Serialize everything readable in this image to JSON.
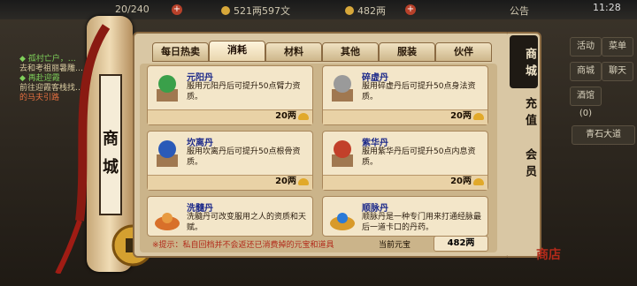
{
  "topbar": {
    "stamina": "20/240",
    "coins": "521两597文",
    "ingots": "482两",
    "notice": "公告",
    "time": "11:28"
  },
  "left_quest": {
    "line1": "◆ 孤村亡户，…",
    "line2": "去和考祖丽暑雕…",
    "line3": "◆ 再赴迎霞",
    "line4": "前往迎霞客栈找…",
    "line5": "的马夫引路"
  },
  "right_menu": {
    "b1": "活动",
    "b2": "菜单",
    "b3": "商城",
    "b4": "聊天",
    "b5": "酒馆(0)",
    "b6": "",
    "road": "青石大道"
  },
  "shop": {
    "title": "商城",
    "tabs": [
      "每日热卖",
      "消耗",
      "材料",
      "其他",
      "服装",
      "伙伴"
    ],
    "active_tab": "消耗",
    "right_tabs": [
      "商城",
      "充值",
      "会员"
    ],
    "items": [
      {
        "name": "元阳丹",
        "desc": "服用元阳丹后可提升50点臂力资质。",
        "price": "20两",
        "color": "#3aa04a"
      },
      {
        "name": "碎虚丹",
        "desc": "服用碎虚丹后可提升50点身法资质。",
        "price": "20两",
        "color": "#9a9a9a"
      },
      {
        "name": "坎离丹",
        "desc": "服用坎离丹后可提升50点根骨资质。",
        "price": "20两",
        "color": "#2a5ab8"
      },
      {
        "name": "紫华丹",
        "desc": "服用紫华丹后可提升50点内息资质。",
        "price": "20两",
        "color": "#c2402a"
      },
      {
        "name": "洗髓丹",
        "desc": "洗髓丹可改变服用之人的资质和天赋。",
        "price": "",
        "color": "#e0702a"
      },
      {
        "name": "顺脉丹",
        "desc": "顺脉丹是一种专门用来打通经脉最后一道卡口的丹药。",
        "price": "",
        "color": "#2a7ad8"
      }
    ],
    "tip": "※提示：私自回档并不会返还已消费掉的元宝和道具",
    "current_label": "当前元宝",
    "current_value": "482两"
  },
  "seal": "商店"
}
